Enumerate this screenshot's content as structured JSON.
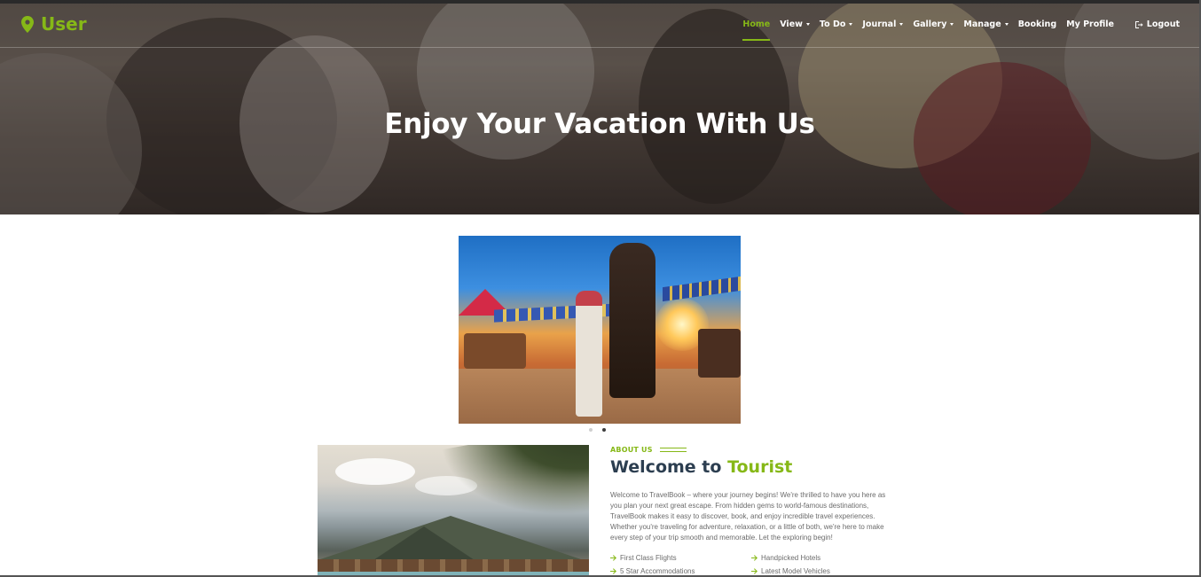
{
  "brand": {
    "name": "User",
    "icon": "map-marker-icon",
    "color": "#86b817"
  },
  "nav": {
    "items": [
      {
        "label": "Home",
        "active": true,
        "dropdown": false
      },
      {
        "label": "View",
        "active": false,
        "dropdown": true
      },
      {
        "label": "To Do",
        "active": false,
        "dropdown": true
      },
      {
        "label": "Journal",
        "active": false,
        "dropdown": true
      },
      {
        "label": "Gallery",
        "active": false,
        "dropdown": true
      },
      {
        "label": "Manage",
        "active": false,
        "dropdown": true
      },
      {
        "label": "Booking",
        "active": false,
        "dropdown": false
      },
      {
        "label": "My Profile",
        "active": false,
        "dropdown": false
      }
    ],
    "logout": {
      "label": "Logout",
      "icon": "logout-icon"
    }
  },
  "hero": {
    "title": "Enjoy Your Vacation With Us"
  },
  "carousel": {
    "slide_count": 2,
    "active_index": 1
  },
  "about": {
    "eyebrow": "ABOUT US",
    "title_main": "Welcome to",
    "title_accent": "Tourist",
    "paragraph": "Welcome to TravelBook – where your journey begins! We're thrilled to have you here as you plan your next great escape. From hidden gems to world-famous destinations, TravelBook makes it easy to discover, book, and enjoy incredible travel experiences. Whether you're traveling for adventure, relaxation, or a little of both, we're here to make every step of your trip smooth and memorable. Let the exploring begin!",
    "features": [
      "First Class Flights",
      "Handpicked Hotels",
      "5 Star Accommodations",
      "Latest Model Vehicles"
    ]
  },
  "colors": {
    "accent": "#86b817",
    "heading": "#2c3e50",
    "body_text": "#6b6b6b"
  }
}
